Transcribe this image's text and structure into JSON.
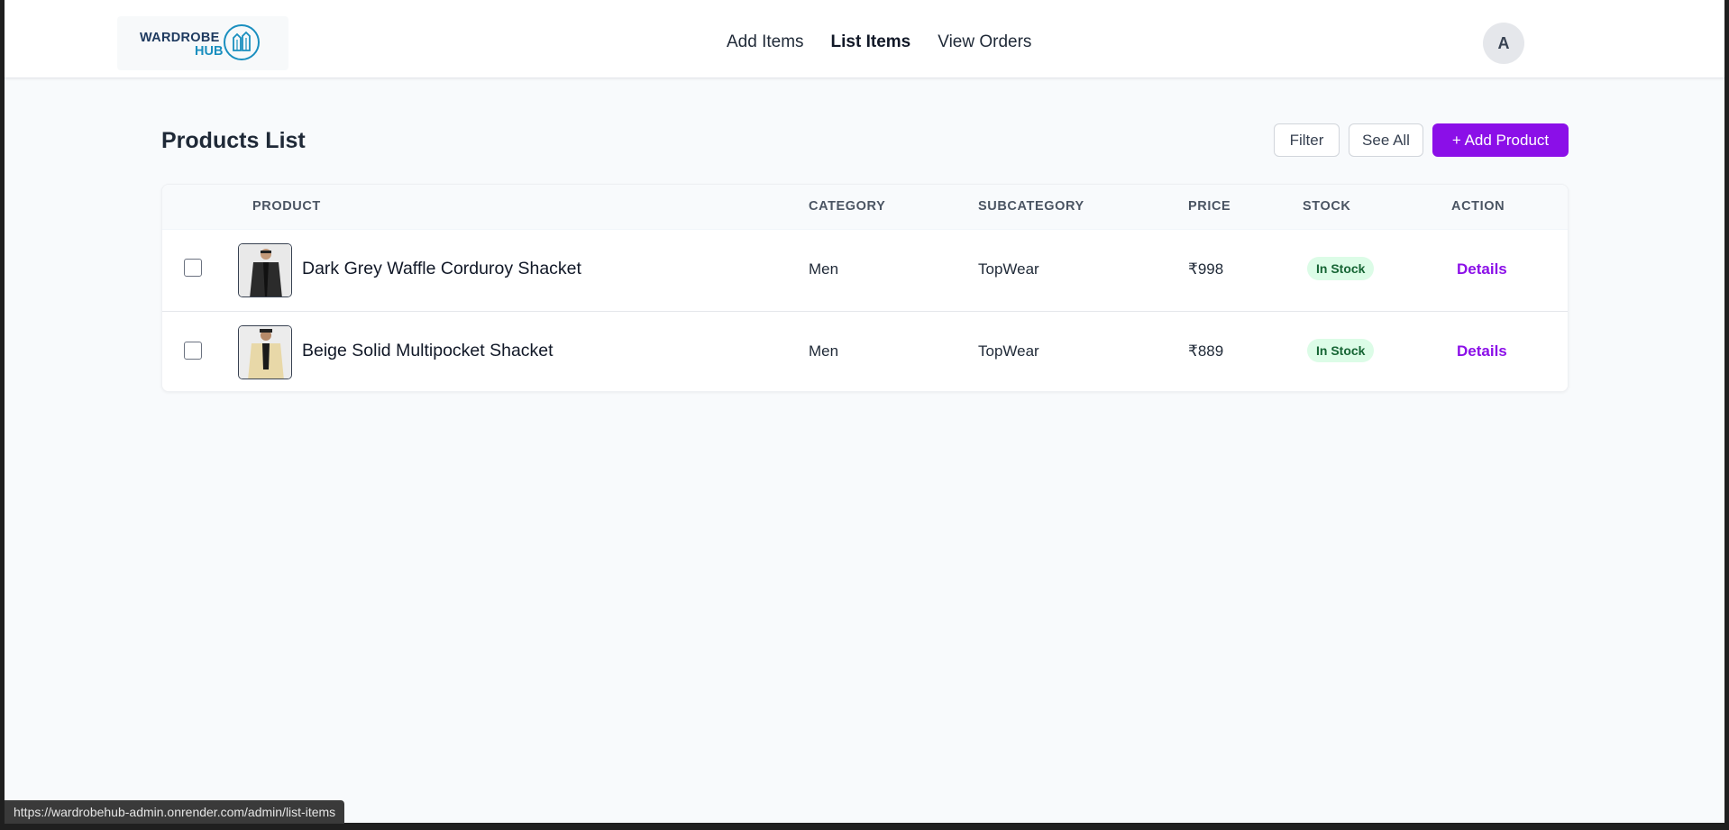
{
  "brand": {
    "line1": "WARDROBE",
    "line2": "HUB"
  },
  "nav": {
    "items": [
      "Add Items",
      "List Items",
      "View Orders"
    ],
    "active": "List Items"
  },
  "user": {
    "avatar_initial": "A"
  },
  "page": {
    "title": "Products List",
    "buttons": {
      "filter": "Filter",
      "see_all": "See All",
      "add_product": "+ Add Product"
    }
  },
  "table": {
    "columns": [
      "PRODUCT",
      "CATEGORY",
      "SUBCATEGORY",
      "PRICE",
      "STOCK",
      "ACTION"
    ],
    "rows": [
      {
        "name": "Dark Grey Waffle Corduroy Shacket",
        "category": "Men",
        "subcategory": "TopWear",
        "price": "₹998",
        "stock": "In Stock",
        "action": "Details",
        "thumb_color": "dark"
      },
      {
        "name": "Beige Solid Multipocket Shacket",
        "category": "Men",
        "subcategory": "TopWear",
        "price": "₹889",
        "stock": "In Stock",
        "action": "Details",
        "thumb_color": "beige"
      }
    ]
  },
  "status_url": "https://wardrobehub-admin.onrender.com/admin/list-items",
  "colors": {
    "accent": "#8b0fe8",
    "stock_bg": "#dcfce7",
    "stock_text": "#166534"
  }
}
